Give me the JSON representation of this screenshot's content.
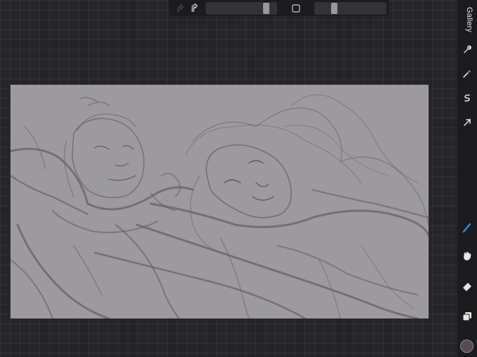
{
  "app": {
    "gallery_label": "Gallery"
  },
  "topbar": {
    "icons": [
      "undo-arrow-icon",
      "redo-arrow-icon",
      "square-modify-icon"
    ],
    "brush_size_level": 0.88,
    "opacity_level": 0.26
  },
  "sidebar": {
    "tools": [
      "wrench-icon",
      "magic-wand-icon",
      "selection-s-icon",
      "transform-arrow-icon",
      "brush-icon",
      "smudge-icon",
      "eraser-icon",
      "layers-icon"
    ],
    "active_tool": "brush-icon",
    "current_color": "#5a4a58"
  },
  "canvas": {
    "background_color": "#9c9a9d",
    "stroke_color": "#5f5068"
  }
}
